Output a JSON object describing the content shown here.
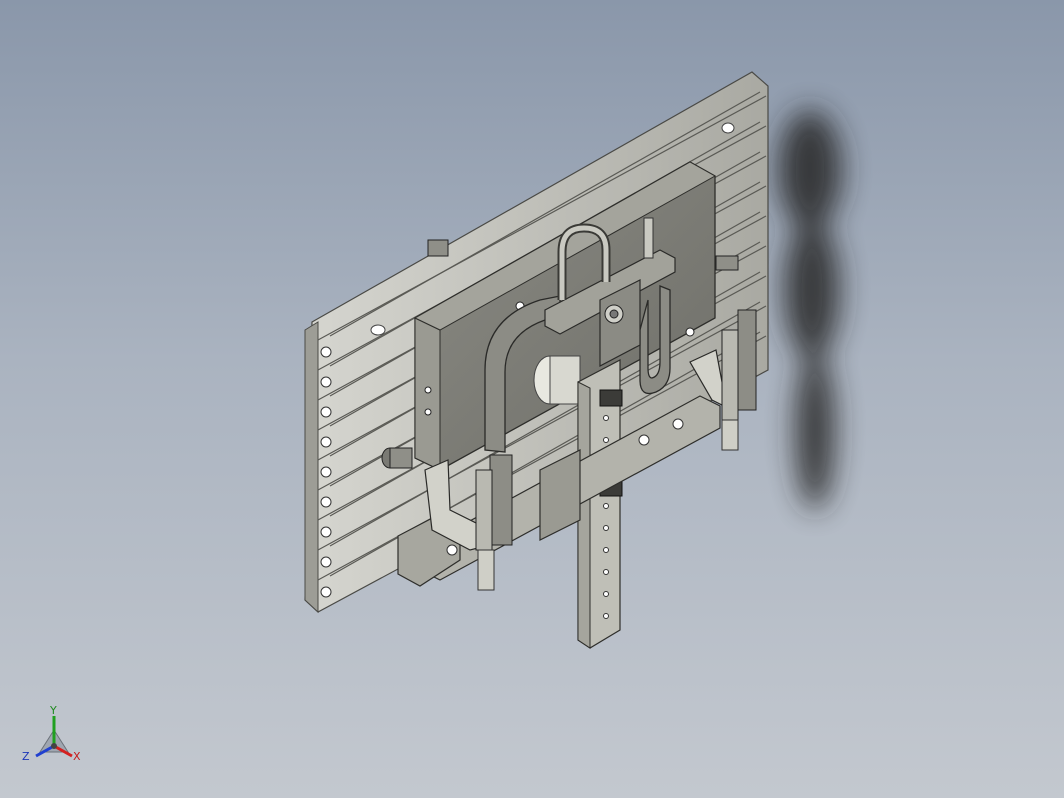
{
  "viewport": {
    "background_top": "#8a97aa",
    "background_bottom": "#c3c8cf"
  },
  "model": {
    "part_color": "#b9b9b0",
    "dark_color": "#7d7d76",
    "shadow_color": "#2a2a2a"
  },
  "triad": {
    "x_label": "X",
    "y_label": "Y",
    "z_label": "Z",
    "x_color": "#d42020",
    "y_color": "#20a020",
    "z_color": "#2040d0"
  }
}
